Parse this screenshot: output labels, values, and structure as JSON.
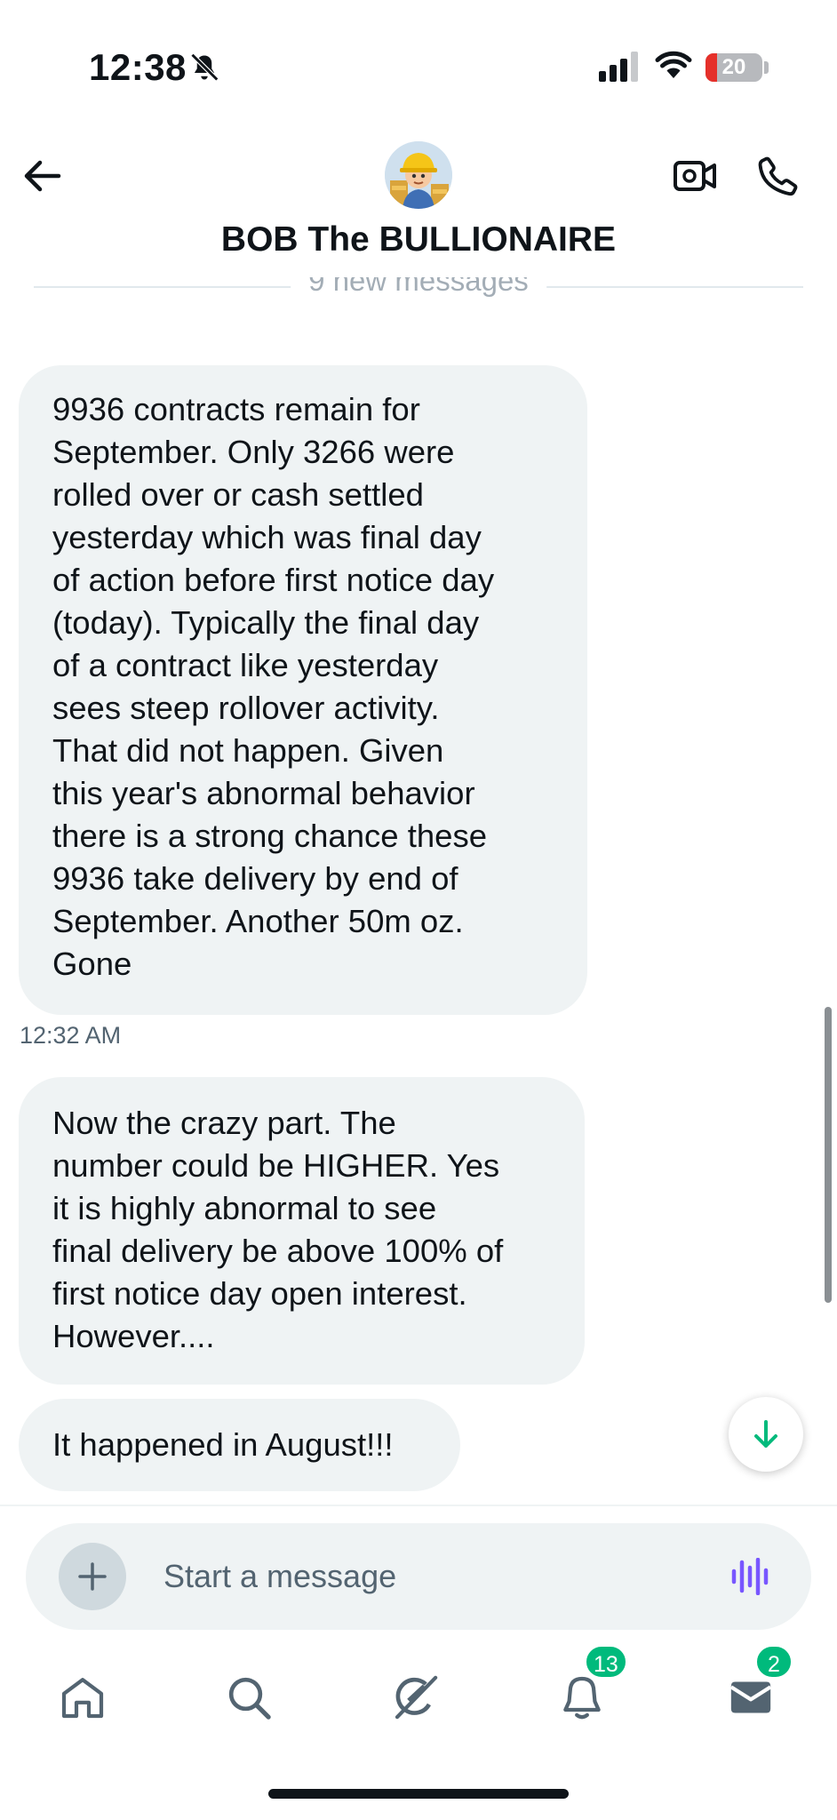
{
  "status_bar": {
    "time": "12:38",
    "battery_level": "20",
    "battery_fraction": 0.2,
    "icons": [
      "bell-muted-icon",
      "signal-icon",
      "wifi-icon",
      "battery-icon"
    ]
  },
  "header": {
    "title": "BOB The BULLIONAIRE",
    "icons": [
      "back-arrow-icon",
      "avatar",
      "video-call-icon",
      "phone-call-icon"
    ]
  },
  "divider": {
    "text": "9 new messages"
  },
  "messages": [
    {
      "lines": [
        "9936 contracts remain for",
        "September.   Only 3266 were",
        "rolled over or cash settled",
        "yesterday which was final day",
        "of action before first notice day",
        "(today).  Typically the final day",
        "of a contract like yesterday",
        "sees steep rollover activity.",
        "That did not happen.  Given",
        "this year's abnormal behavior",
        "there is a strong chance these",
        "9936 take delivery by end of",
        "September.   Another 50m oz.",
        "Gone"
      ],
      "timestamp": "12:32 AM"
    },
    {
      "lines": [
        "Now the crazy part.   The",
        "number could be HIGHER.   Yes",
        "it is highly abnormal to see",
        "final delivery be above 100% of",
        "first notice day open interest.",
        "However...."
      ]
    },
    {
      "lines": [
        "It happened in August!!!"
      ]
    }
  ],
  "composer": {
    "placeholder": "Start a message",
    "value": ""
  },
  "nav": {
    "items": [
      {
        "icon": "home-icon",
        "badge": ""
      },
      {
        "icon": "search-icon",
        "badge": ""
      },
      {
        "icon": "grok-icon",
        "badge": ""
      },
      {
        "icon": "notifications-icon",
        "badge": "13"
      },
      {
        "icon": "messages-icon",
        "badge": "2"
      }
    ]
  },
  "colors": {
    "accent_green": "#00ba7c",
    "bubble_bg": "#eff3f4",
    "voice_purple": "#7856ff",
    "battery_red": "#e5302a"
  }
}
